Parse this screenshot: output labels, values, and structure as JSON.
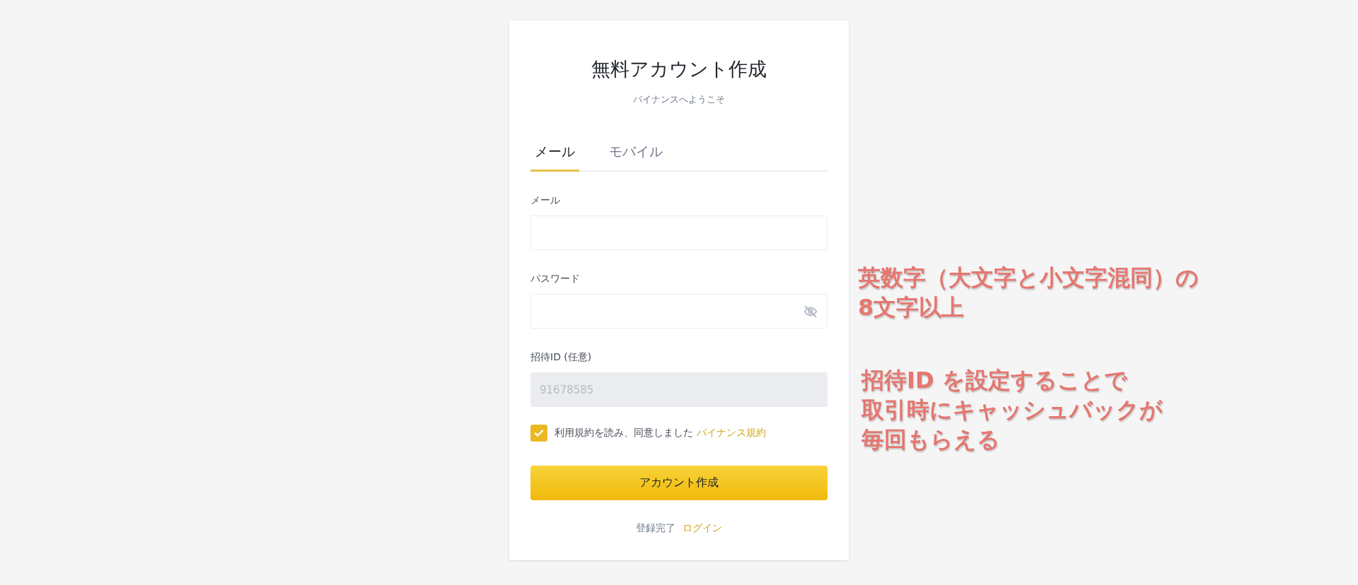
{
  "card": {
    "title": "無料アカウント作成",
    "subtitle": "バイナンスへようこそ",
    "tabs": [
      {
        "label": "メール",
        "selected": true
      },
      {
        "label": "モバイル",
        "selected": false
      }
    ],
    "fields": [
      {
        "kind": "text",
        "label": "メール",
        "disabled": false
      },
      {
        "kind": "password",
        "label": "パスワード",
        "disabled": false
      },
      {
        "kind": "text",
        "label": "招待ID (任意)",
        "value": "91678585",
        "disabled": true
      }
    ],
    "terms": {
      "checked": true,
      "text": "利用規約を読み、同意しました",
      "link": "バイナンス規約"
    },
    "submit": "アカウント作成",
    "footer": {
      "text": "登録完了",
      "link": "ログイン"
    }
  },
  "annotations": [
    {
      "lines": [
        "英数字（大文字と小文字混同）の",
        "8文字以上"
      ]
    },
    {
      "lines": [
        "招待ID を設定することで",
        "取引時にキャッシュバックが",
        "毎回もらえる"
      ]
    }
  ]
}
